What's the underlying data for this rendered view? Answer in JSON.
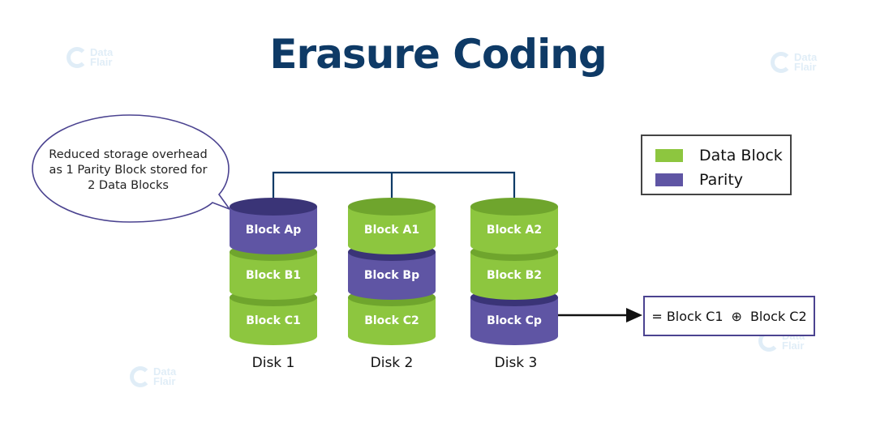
{
  "title": "Erasure Coding",
  "watermark": {
    "line1": "Data",
    "line2": "Flair"
  },
  "callout": {
    "lines": [
      "Reduced storage overhead",
      "as 1 Parity Block stored for",
      "2 Data Blocks"
    ]
  },
  "colors": {
    "data_block": "#8dc63f",
    "data_block_top": "#6fa52d",
    "parity": "#5f55a4",
    "parity_top": "#3a3477",
    "title": "#0e3a66",
    "connector": "#0e3a66"
  },
  "legend": {
    "items": [
      {
        "label": "Data Block",
        "type": "data"
      },
      {
        "label": "Parity",
        "type": "parity"
      }
    ]
  },
  "disks": [
    {
      "label": "Disk 1",
      "blocks": [
        {
          "label": "Block Ap",
          "type": "parity"
        },
        {
          "label": "Block B1",
          "type": "data"
        },
        {
          "label": "Block C1",
          "type": "data"
        }
      ]
    },
    {
      "label": "Disk 2",
      "blocks": [
        {
          "label": "Block A1",
          "type": "data"
        },
        {
          "label": "Block Bp",
          "type": "parity"
        },
        {
          "label": "Block C2",
          "type": "data"
        }
      ]
    },
    {
      "label": "Disk 3",
      "blocks": [
        {
          "label": "Block A2",
          "type": "data"
        },
        {
          "label": "Block B2",
          "type": "data"
        },
        {
          "label": "Block Cp",
          "type": "parity"
        }
      ]
    }
  ],
  "formula": {
    "prefix": "= Block C1",
    "operator": "⊕",
    "suffix": "Block C2"
  }
}
